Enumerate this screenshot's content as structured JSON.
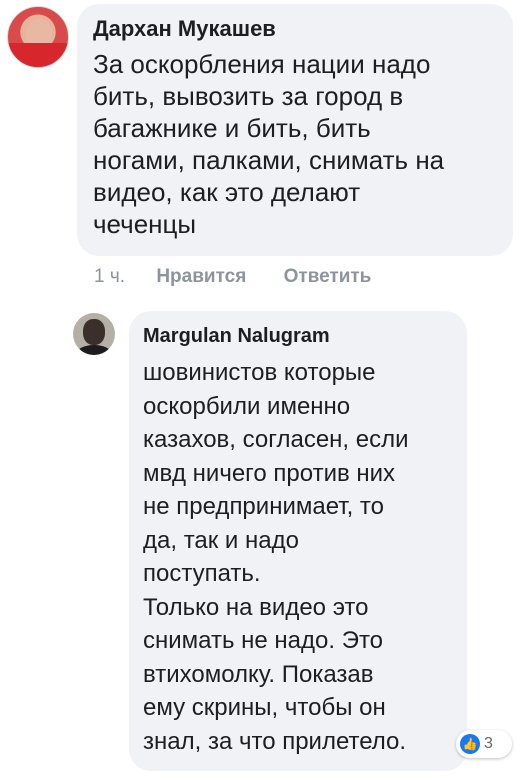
{
  "comment1": {
    "author": "Дархан Мукашев",
    "text": "За оскорбления нации надо\nбить, вывозить за город в\nбагажнике и бить, бить\nногами, палками, снимать на\nвидео, как это делают\nчеченцы"
  },
  "actions": {
    "time": "1 ч.",
    "like_label": "Нравится",
    "reply_label": "Ответить"
  },
  "comment2": {
    "author": "Margulan Nalugram",
    "text": "шовинистов которые\nоскорбили именно\nказахов, согласен, если\nмвд ничего против них\nне предпринимает, то\nда, так и надо\nпоступать.\nТолько на видео это\nснимать не надо. Это\nвтихомолку. Показав\nему скрины, чтобы он\nзнал, за что прилетело.",
    "reaction_icon": "like-icon",
    "reaction_count": "3"
  },
  "colors": {
    "bubble_bg": "#f0f2f5",
    "meta_text": "#8d949e",
    "like_blue": "#1877f2"
  }
}
